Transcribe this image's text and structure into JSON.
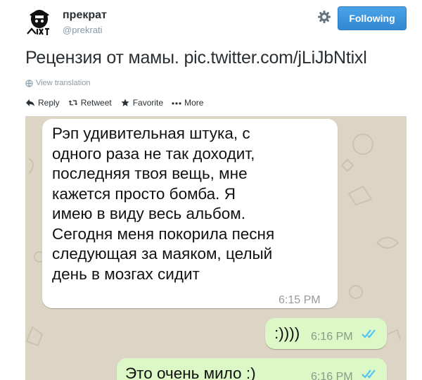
{
  "header": {
    "name": "прекрат",
    "handle": "@prekrati",
    "follow_label": "Following"
  },
  "tweet": {
    "text": "Рецензия от мамы.",
    "link": "pic.twitter.com/jLiJbNtixl",
    "translate_label": "View translation"
  },
  "actions": {
    "reply": "Reply",
    "retweet": "Retweet",
    "favorite": "Favorite",
    "more": "More"
  },
  "chat": {
    "incoming": {
      "lines": [
        "Рэп удивительная штука, с",
        "одного раза не так доходит,",
        "последняя твоя вещь, мне",
        "кажется просто бомба. Я",
        "имею в виду весь  альбом.",
        "Сегодня меня покорила песня",
        "следующая за маяком, целый",
        "день в мозгах сидит"
      ],
      "time": "6:15 PM"
    },
    "outgoing": [
      {
        "text": ":))))",
        "time": "6:16 PM"
      },
      {
        "text": "Это очень мило :)",
        "time": "6:16 PM"
      }
    ],
    "colors": {
      "incoming": "#ffffff",
      "outgoing": "#dcf8c6",
      "ticks": "#4fc3f7"
    }
  },
  "icons": [
    "avatar",
    "gear-icon",
    "globe-icon",
    "reply-icon",
    "retweet-icon",
    "star-icon",
    "more-icon",
    "double-check-icon"
  ]
}
